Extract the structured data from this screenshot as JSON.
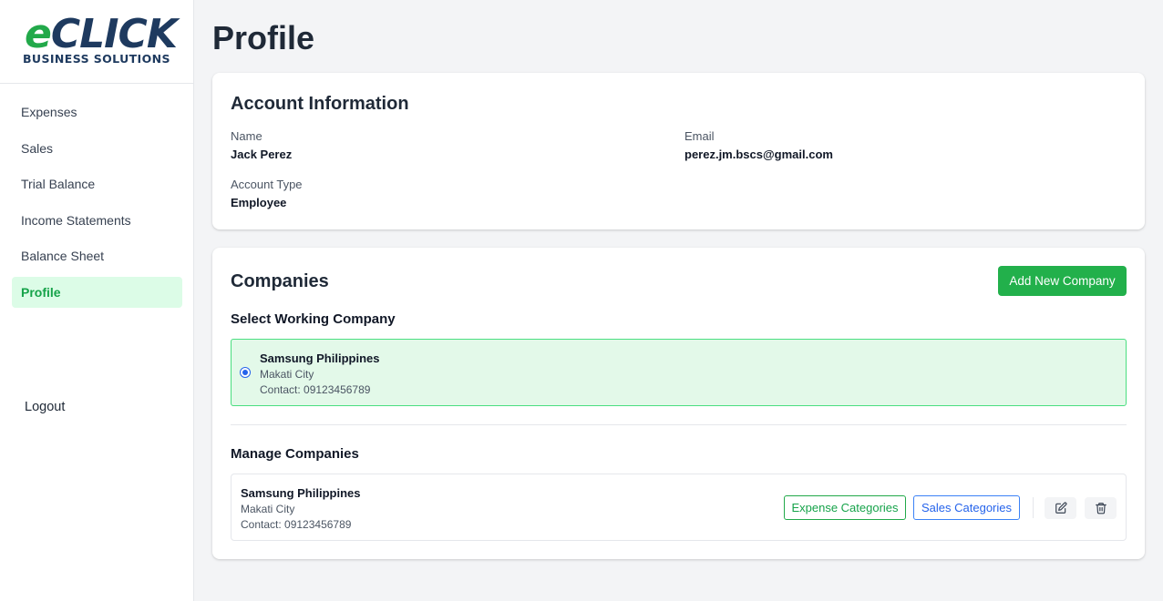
{
  "brand": {
    "logo_e": "e",
    "logo_rest": "CLICK",
    "logo_sub": "BUSINESS SOLUTIONS"
  },
  "sidebar": {
    "items": [
      {
        "label": "Expenses"
      },
      {
        "label": "Sales"
      },
      {
        "label": "Trial Balance"
      },
      {
        "label": "Income Statements"
      },
      {
        "label": "Balance Sheet"
      },
      {
        "label": "Profile",
        "active": true
      }
    ],
    "logout_label": "Logout"
  },
  "page": {
    "title": "Profile"
  },
  "account": {
    "heading": "Account Information",
    "name_label": "Name",
    "name_value": "Jack Perez",
    "email_label": "Email",
    "email_value": "perez.jm.bscs@gmail.com",
    "type_label": "Account Type",
    "type_value": "Employee"
  },
  "companies": {
    "heading": "Companies",
    "add_button": "Add New Company",
    "select_heading": "Select Working Company",
    "selected": {
      "name": "Samsung Philippines",
      "city": "Makati City",
      "contact": "Contact: 09123456789"
    },
    "manage_heading": "Manage Companies",
    "manage_rows": [
      {
        "name": "Samsung Philippines",
        "city": "Makati City",
        "contact": "Contact: 09123456789",
        "expense_button": "Expense Categories",
        "sales_button": "Sales Categories",
        "edit_icon": "edit-icon",
        "delete_icon": "trash-icon"
      }
    ]
  },
  "colors": {
    "accent_green": "#22b04b",
    "active_nav_bg": "#dcfce7",
    "selected_company_bg": "#e3f9e9",
    "brand_navy": "#1e3a5f",
    "sales_blue": "#2563eb"
  }
}
